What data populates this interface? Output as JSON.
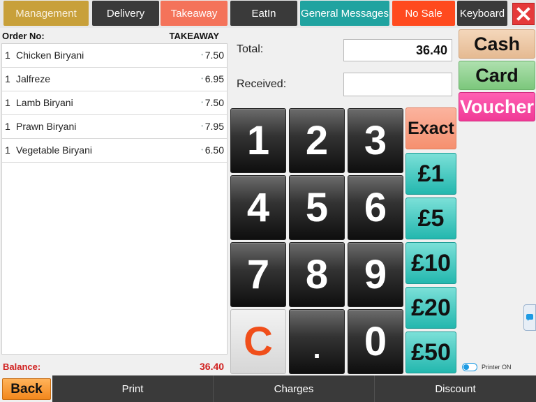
{
  "tabs": {
    "management": "Management",
    "delivery": "Delivery",
    "takeaway": "Takeaway",
    "eatin": "EatIn",
    "general_messages": "General Messages",
    "no_sale": "No Sale",
    "keyboard": "Keyboard"
  },
  "order": {
    "no_label": "Order No:",
    "type": "TAKEAWAY",
    "items": [
      {
        "qty": "1",
        "name": "Chicken Biryani",
        "price": "7.50"
      },
      {
        "qty": "1",
        "name": "Jalfreze",
        "price": "6.95"
      },
      {
        "qty": "1",
        "name": "Lamb Biryani",
        "price": "7.50"
      },
      {
        "qty": "1",
        "name": "Prawn Biryani",
        "price": "7.95"
      },
      {
        "qty": "1",
        "name": "Vegetable Biryani",
        "price": "6.50"
      }
    ]
  },
  "balance": {
    "label": "Balance:",
    "value": "36.40"
  },
  "total": {
    "label": "Total:",
    "value": "36.40"
  },
  "received": {
    "label": "Received:",
    "value": ""
  },
  "keypad": {
    "k1": "1",
    "k2": "2",
    "k3": "3",
    "k4": "4",
    "k5": "5",
    "k6": "6",
    "k7": "7",
    "k8": "8",
    "k9": "9",
    "kc": "C",
    "kdot": ".",
    "k0": "0"
  },
  "amounts": {
    "exact": "Exact",
    "a1": "£1",
    "a5": "£5",
    "a10": "£10",
    "a20": "£20",
    "a50": "£50"
  },
  "payment": {
    "cash": "Cash",
    "card": "Card",
    "voucher": "Voucher"
  },
  "printer": {
    "label": "Printer ON",
    "on": true
  },
  "bottom": {
    "back": "Back",
    "print": "Print",
    "charges": "Charges",
    "discount": "Discount"
  },
  "colors": {
    "management": "#c8a03a",
    "takeaway": "#f4735a",
    "general_messages": "#20a3a0",
    "no_sale": "#ff4a1e",
    "close": "#e53a3a",
    "balance": "#d0201f",
    "amount_keys": "#23b7ae",
    "exact": "#f5906f",
    "cash": "#e5ba92",
    "card": "#7cc77c",
    "voucher": "#f03a96",
    "back": "#f2871c"
  },
  "icons": {
    "close": "close-icon",
    "side_widget": "chat-icon"
  }
}
